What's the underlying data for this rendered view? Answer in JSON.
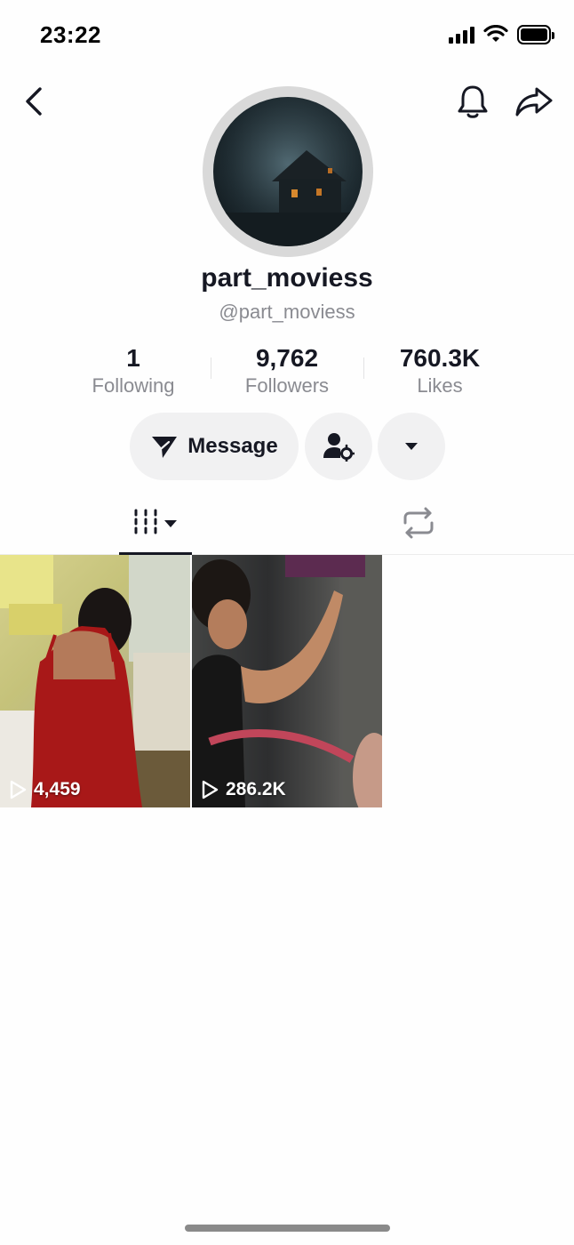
{
  "status_bar": {
    "time": "23:22"
  },
  "profile": {
    "display_name": "part_moviess",
    "handle": "@part_moviess"
  },
  "stats": [
    {
      "value": "1",
      "label": "Following"
    },
    {
      "value": "9,762",
      "label": "Followers"
    },
    {
      "value": "760.3K",
      "label": "Likes"
    }
  ],
  "actions": {
    "message_label": "Message"
  },
  "videos": [
    {
      "views": "4,459"
    },
    {
      "views": "286.2K"
    }
  ],
  "icons": {
    "back": "chevron-left-icon",
    "notifications": "bell-icon",
    "share": "share-arrow-icon",
    "message": "paper-plane-icon",
    "add_friend": "user-gear-icon",
    "more": "caret-down-icon",
    "videos_tab": "grid-columns-icon",
    "reposts_tab": "repost-icon",
    "views": "play-outline-icon"
  },
  "colors": {
    "text_primary": "#161823",
    "text_secondary": "#8a8b91",
    "button_bg": "#f1f1f2"
  }
}
